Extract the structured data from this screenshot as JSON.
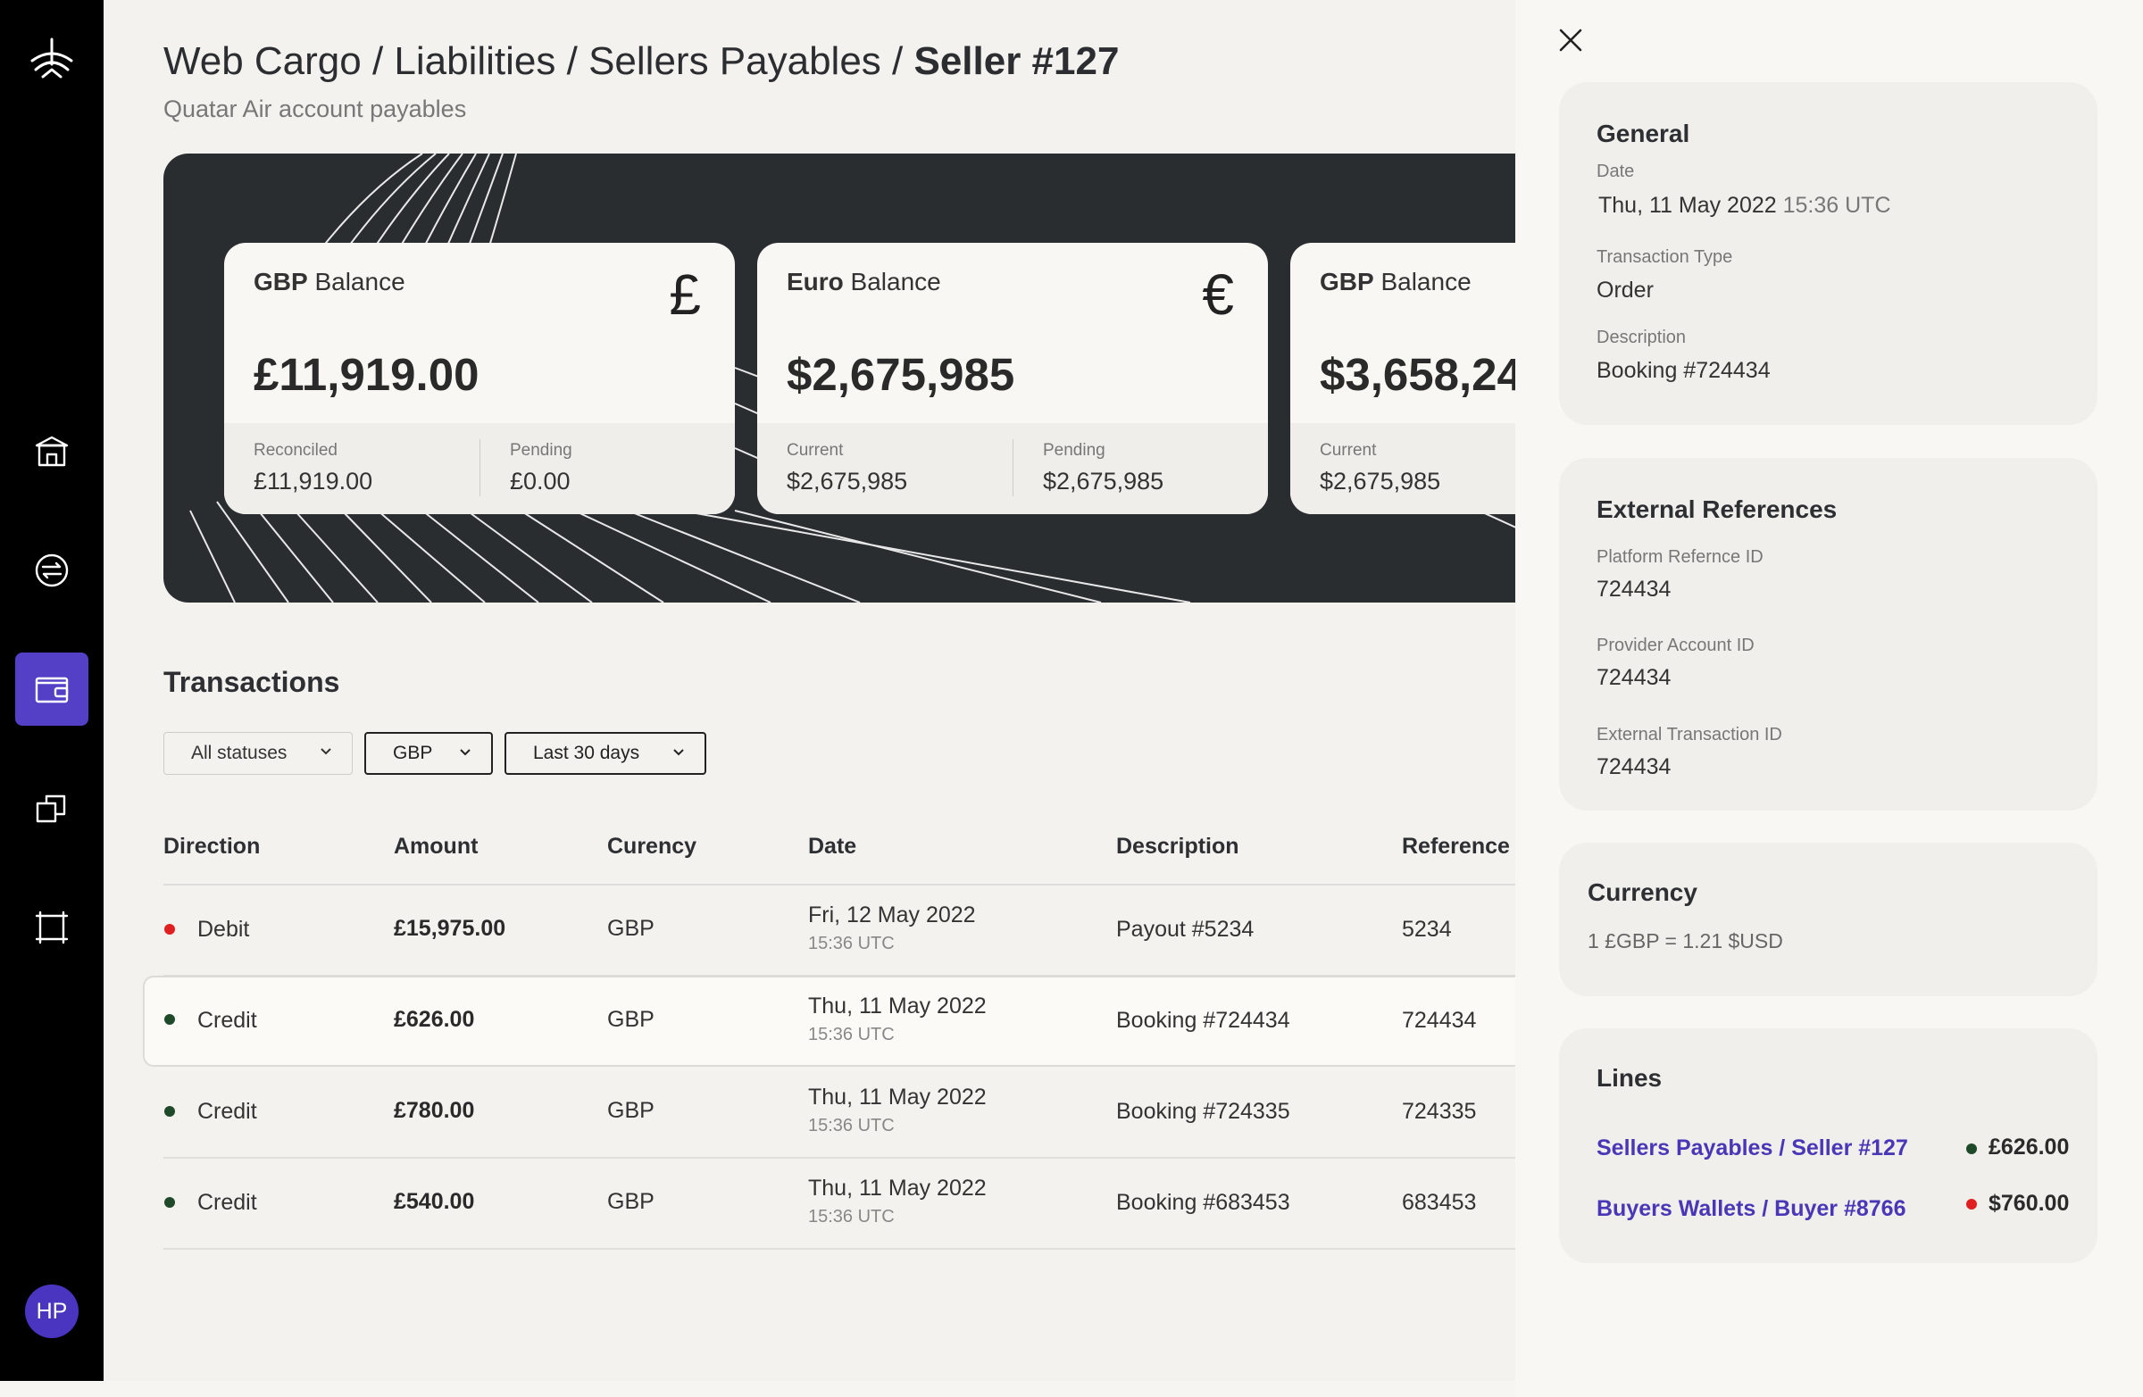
{
  "breadcrumb": {
    "path": "Web Cargo / Liabilities / Sellers Payables / ",
    "current": "Seller #127"
  },
  "subtitle": "Quatar Air account payables",
  "user": {
    "initials": "HP"
  },
  "nav": {
    "items": [
      {
        "icon": "bank-icon"
      },
      {
        "icon": "exchange-icon"
      },
      {
        "icon": "wallet-icon",
        "active": true
      },
      {
        "icon": "copy-icon"
      },
      {
        "icon": "flow-icon"
      }
    ]
  },
  "balances": [
    {
      "currency_bold": "GBP",
      "title_rest": " Balance",
      "symbol": "£",
      "amount": "£11,919.00",
      "left_label": "Reconciled",
      "left_value": "£11,919.00",
      "right_label": "Pending",
      "right_value": "£0.00"
    },
    {
      "currency_bold": "Euro",
      "title_rest": " Balance",
      "symbol": "€",
      "amount": "$2,675,985",
      "left_label": "Current",
      "left_value": "$2,675,985",
      "right_label": "Pending",
      "right_value": "$2,675,985"
    },
    {
      "currency_bold": "GBP",
      "title_rest": " Balance",
      "symbol": "",
      "amount": "$3,658,24",
      "left_label": "Current",
      "left_value": "$2,675,985",
      "right_label": "",
      "right_value": ""
    }
  ],
  "transactions": {
    "title": "Transactions",
    "filters": {
      "status": "All statuses",
      "currency": "GBP",
      "period": "Last 30 days"
    },
    "columns": [
      "Direction",
      "Amount",
      "Curency",
      "Date",
      "Description",
      "Reference I"
    ],
    "rows": [
      {
        "direction": "Debit",
        "amount": "£15,975.00",
        "currency": "GBP",
        "date": "Fri, 12 May 2022",
        "time": "15:36 UTC",
        "description": "Payout #5234",
        "reference": "5234",
        "status_color": "#e02020"
      },
      {
        "direction": "Credit",
        "amount": "£626.00",
        "currency": "GBP",
        "date": "Thu, 11 May 2022",
        "time": "15:36 UTC",
        "description": "Booking #724434",
        "reference": "724434",
        "status_color": "#1e4a2a",
        "selected": true
      },
      {
        "direction": "Credit",
        "amount": "£780.00",
        "currency": "GBP",
        "date": "Thu, 11 May 2022",
        "time": "15:36 UTC",
        "description": "Booking #724335",
        "reference": "724335",
        "status_color": "#1e4a2a"
      },
      {
        "direction": "Credit",
        "amount": "£540.00",
        "currency": "GBP",
        "date": "Thu, 11 May 2022",
        "time": "15:36 UTC",
        "description": "Booking #683453",
        "reference": "683453",
        "status_color": "#1e4a2a"
      }
    ]
  },
  "panel": {
    "general": {
      "title": "General",
      "date_label": "Date",
      "date_value": "Thu, 11 May 2022",
      "date_time": " 15:36 UTC",
      "type_label": "Transaction Type",
      "type_value": "Order",
      "desc_label": "Description",
      "desc_value": "Booking #724434"
    },
    "external": {
      "title": "External References",
      "platform_label": "Platform Refernce ID",
      "platform_value": "724434",
      "provider_label": "Provider Account ID",
      "provider_value": "724434",
      "external_label": "External Transaction ID",
      "external_value": "724434"
    },
    "currency": {
      "title": "Currency",
      "rate": "1 £GBP = 1.21 $USD"
    },
    "lines": {
      "title": "Lines",
      "items": [
        {
          "label": "Sellers Payables / Seller #127",
          "amount": "£626.00",
          "status_color": "#1e4a2a"
        },
        {
          "label": "Buyers Wallets / Buyer #8766",
          "amount": "$760.00",
          "status_color": "#e02020"
        }
      ]
    }
  },
  "colors": {
    "accent": "#5340c7",
    "link": "#4a37b8",
    "hero_bg": "#2a2d30",
    "debit": "#e02020",
    "credit": "#1e4a2a"
  }
}
